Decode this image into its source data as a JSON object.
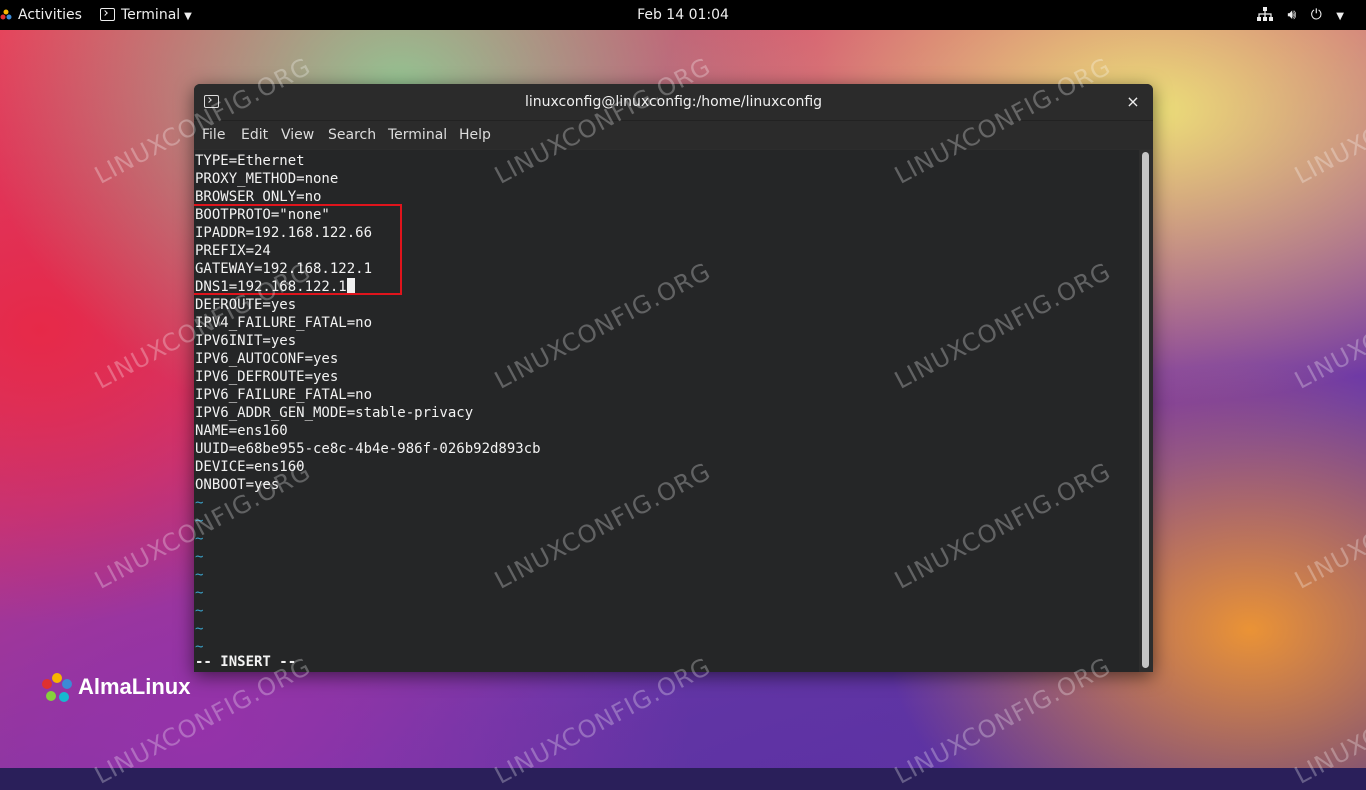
{
  "topbar": {
    "activities": "Activities",
    "app_menu": "Terminal",
    "clock": "Feb 14  01:04",
    "icons": [
      "network-icon",
      "volume-icon",
      "power-icon",
      "chevron-down-icon"
    ]
  },
  "window": {
    "title": "linuxconfig@linuxconfig:/home/linuxconfig",
    "close_glyph": "×",
    "menu": [
      "File",
      "Edit",
      "View",
      "Search",
      "Terminal",
      "Help"
    ]
  },
  "editor": {
    "lines": [
      "TYPE=Ethernet",
      "PROXY_METHOD=none",
      "BROWSER_ONLY=no",
      "BOOTPROTO=\"none\"",
      "IPADDR=192.168.122.66",
      "PREFIX=24",
      "GATEWAY=192.168.122.1",
      "DNS1=192.168.122.1",
      "DEFROUTE=yes",
      "IPV4_FAILURE_FATAL=no",
      "IPV6INIT=yes",
      "IPV6_AUTOCONF=yes",
      "IPV6_DEFROUTE=yes",
      "IPV6_FAILURE_FATAL=no",
      "IPV6_ADDR_GEN_MODE=stable-privacy",
      "NAME=ens160",
      "UUID=e68be955-ce8c-4b4e-986f-026b92d893cb",
      "DEVICE=ens160",
      "ONBOOT=yes"
    ],
    "cursor_line": 7,
    "empty_line_marker": "~",
    "empty_line_count": 9,
    "mode": "-- INSERT --"
  },
  "logo": {
    "text": "AlmaLinux"
  },
  "watermark": "LINUXCONFIG.ORG",
  "colors": {
    "highlight_box": "#e0141c",
    "tilde": "#3aa0c8",
    "terminal_bg": "#252627"
  }
}
